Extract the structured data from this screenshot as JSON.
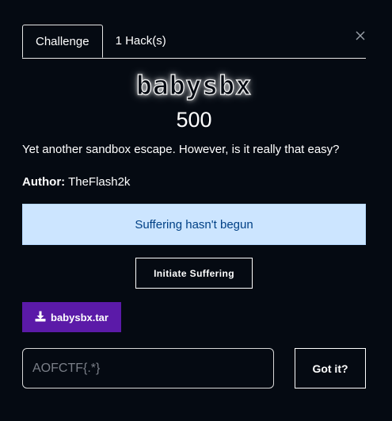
{
  "tabs": [
    {
      "label": "Challenge",
      "active": true
    },
    {
      "label": "1 Hack(s)",
      "active": false
    }
  ],
  "challenge": {
    "name": "babysbx",
    "points": "500",
    "description": "Yet another sandbox escape. However, is it really that easy?",
    "author_label": "Author:",
    "author_name": "TheFlash2k"
  },
  "alert": {
    "text": "Suffering hasn't begun"
  },
  "actions": {
    "initiate_label": "Initiate Suffering",
    "download_label": "babysbx.tar",
    "submit_label": "Got it?"
  },
  "flag_input": {
    "value": "",
    "placeholder": "AOFCTF{.*}"
  },
  "icons": {
    "close": "close-icon",
    "download": "download-icon"
  },
  "colors": {
    "background": "#050a12",
    "alert_bg": "#cce5ff",
    "alert_text": "#004085",
    "download_bg": "#5b1aa8"
  }
}
